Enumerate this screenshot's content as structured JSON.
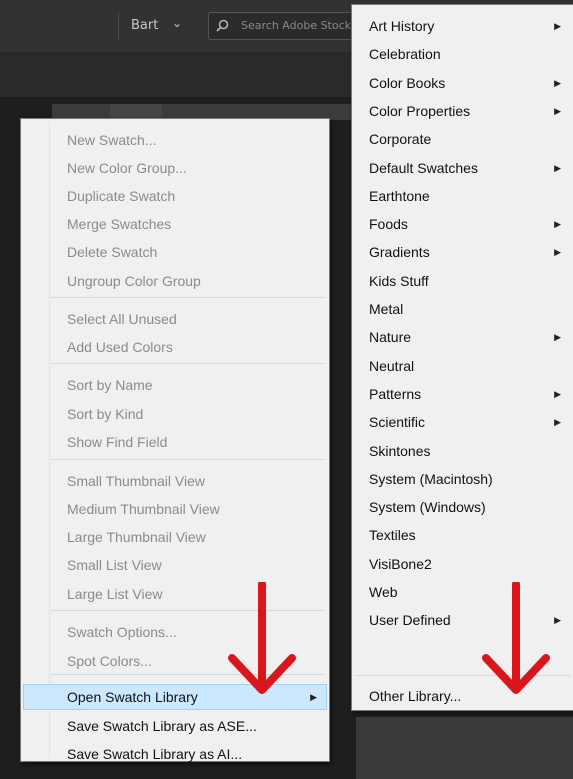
{
  "topbar": {
    "user_label": "Bart",
    "user_caret": "⌄",
    "search_placeholder": "Search Adobe Stock",
    "search_icon": "search-icon"
  },
  "main_menu": {
    "items": [
      {
        "label": "New Swatch...",
        "enabled": false
      },
      {
        "label": "New Color Group...",
        "enabled": false
      },
      {
        "label": "Duplicate Swatch",
        "enabled": false
      },
      {
        "label": "Merge Swatches",
        "enabled": false
      },
      {
        "label": "Delete Swatch",
        "enabled": false
      },
      {
        "label": "Ungroup Color Group",
        "enabled": false
      },
      {
        "label": "Select All Unused",
        "enabled": false
      },
      {
        "label": "Add Used Colors",
        "enabled": false
      },
      {
        "label": "Sort by Name",
        "enabled": false
      },
      {
        "label": "Sort by Kind",
        "enabled": false
      },
      {
        "label": "Show Find Field",
        "enabled": false
      },
      {
        "label": "Small Thumbnail View",
        "enabled": false
      },
      {
        "label": "Medium Thumbnail View",
        "enabled": false
      },
      {
        "label": "Large Thumbnail View",
        "enabled": false
      },
      {
        "label": "Small List View",
        "enabled": false
      },
      {
        "label": "Large List View",
        "enabled": false
      },
      {
        "label": "Swatch Options...",
        "enabled": false
      },
      {
        "label": "Spot Colors...",
        "enabled": false
      },
      {
        "label": "Open Swatch Library",
        "enabled": true,
        "submenu": true,
        "highlighted": true
      },
      {
        "label": "Save Swatch Library as ASE...",
        "enabled": true
      },
      {
        "label": "Save Swatch Library as AI...",
        "enabled": true
      }
    ],
    "arrow_glyph": "▶"
  },
  "library_submenu": {
    "items": [
      {
        "label": "Art History",
        "submenu": true
      },
      {
        "label": "Celebration"
      },
      {
        "label": "Color Books",
        "submenu": true
      },
      {
        "label": "Color Properties",
        "submenu": true
      },
      {
        "label": "Corporate"
      },
      {
        "label": "Default Swatches",
        "submenu": true
      },
      {
        "label": "Earthtone"
      },
      {
        "label": "Foods",
        "submenu": true
      },
      {
        "label": "Gradients",
        "submenu": true
      },
      {
        "label": "Kids Stuff"
      },
      {
        "label": "Metal"
      },
      {
        "label": "Nature",
        "submenu": true
      },
      {
        "label": "Neutral"
      },
      {
        "label": "Patterns",
        "submenu": true
      },
      {
        "label": "Scientific",
        "submenu": true
      },
      {
        "label": "Skintones"
      },
      {
        "label": "System (Macintosh)"
      },
      {
        "label": "System (Windows)"
      },
      {
        "label": "Textiles"
      },
      {
        "label": "VisiBone2"
      },
      {
        "label": "Web"
      },
      {
        "label": "User Defined",
        "submenu": true
      },
      {
        "label": "Other Library..."
      }
    ],
    "arrow_glyph": "▶"
  },
  "colors": {
    "menu_bg": "#f0f0f0",
    "highlight_bg": "#cce8ff",
    "highlight_border": "#99d1ff",
    "disabled_text": "#8b8b8b",
    "enabled_text": "#111111",
    "annotation_arrow": "#d9161c"
  }
}
